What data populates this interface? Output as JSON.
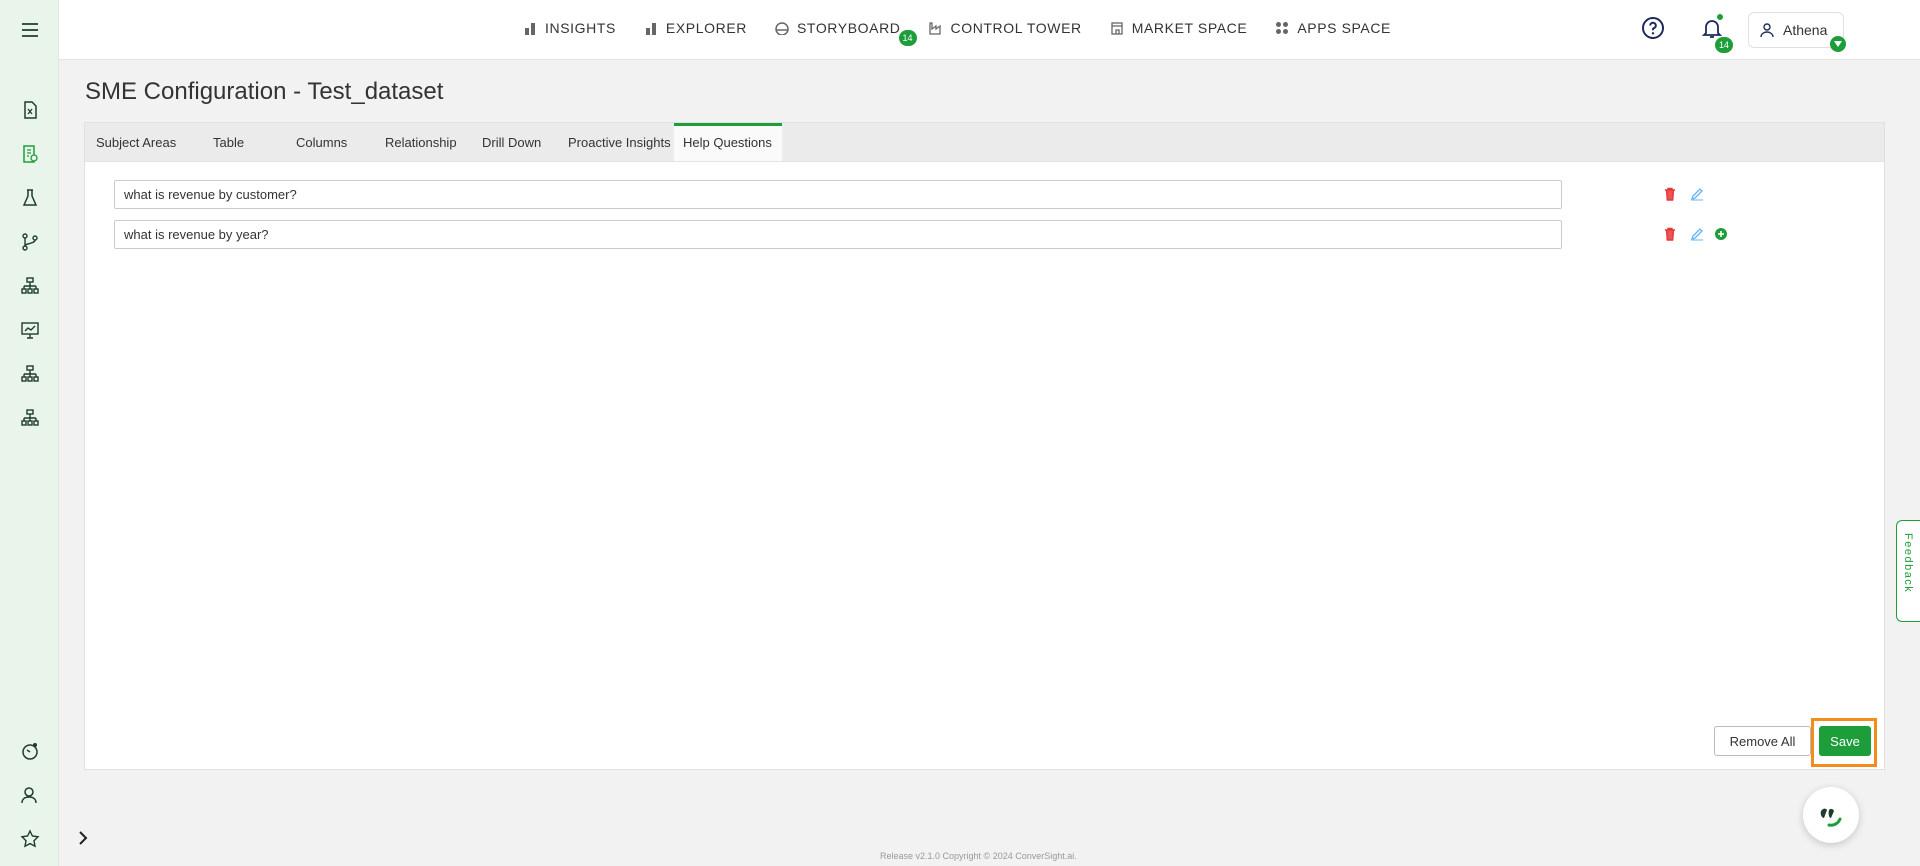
{
  "nav": {
    "items": [
      {
        "label": "INSIGHTS",
        "icon": "bar-chart-icon"
      },
      {
        "label": "EXPLORER",
        "icon": "bar-chart-icon"
      },
      {
        "label": "STORYBOARD",
        "icon": "dashboard-icon",
        "badge": "14"
      },
      {
        "label": "CONTROL TOWER",
        "icon": "factory-icon"
      },
      {
        "label": "MARKET SPACE",
        "icon": "store-icon"
      },
      {
        "label": "APPS SPACE",
        "icon": "grid-icon"
      }
    ]
  },
  "header": {
    "notifications_badge": "14",
    "user_name": "Athena"
  },
  "page": {
    "title": "SME Configuration - Test_dataset"
  },
  "tabs": [
    {
      "label": "Subject Areas",
      "active": false
    },
    {
      "label": "Table",
      "active": false
    },
    {
      "label": "Columns",
      "active": false
    },
    {
      "label": "Relationship",
      "active": false
    },
    {
      "label": "Drill Down",
      "active": false
    },
    {
      "label": "Proactive Insights",
      "active": false
    },
    {
      "label": "Help Questions",
      "active": true
    }
  ],
  "help_questions": [
    "what is revenue by customer?",
    "what is revenue by year?"
  ],
  "buttons": {
    "remove_all": "Remove All",
    "save": "Save"
  },
  "feedback_label": "Feedback",
  "footer_text": "Release v2.1.0 Copyright © 2024 ConverSight.ai.",
  "colors": {
    "accent": "#1e9e3a",
    "highlight": "#f28c1b",
    "delete": "#e53935",
    "edit": "#64b5f6"
  }
}
